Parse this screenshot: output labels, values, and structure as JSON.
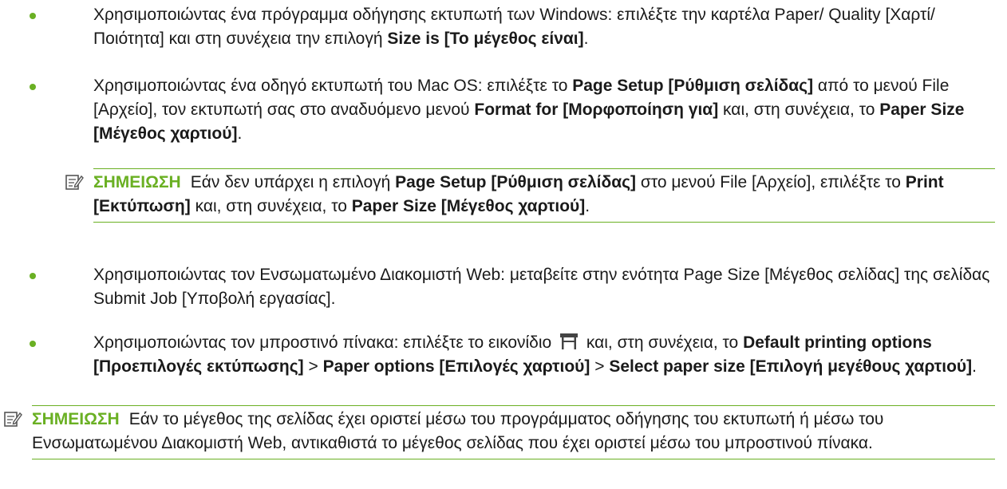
{
  "bullets": [
    {
      "parts": [
        {
          "t": "Χρησιμοποιώντας ένα πρόγραμμα οδήγησης εκτυπωτή των Windows: επιλέξτε την καρτέλα Paper/ Quality [Χαρτί/Ποιότητα] και στη συνέχεια την επιλογή "
        },
        {
          "t": "Size is [Το μέγεθος είναι]",
          "b": true
        },
        {
          "t": "."
        }
      ]
    },
    {
      "parts": [
        {
          "t": "Χρησιμοποιώντας ένα οδηγό εκτυπωτή του Mac OS: επιλέξτε το "
        },
        {
          "t": "Page Setup [Ρύθμιση σελίδας]",
          "b": true
        },
        {
          "t": " από το μενού File [Αρχείο], τον εκτυπωτή σας στο αναδυόμενο μενού "
        },
        {
          "t": "Format for [Μορφοποίηση για]",
          "b": true
        },
        {
          "t": " και, στη συνέχεια, το "
        },
        {
          "t": "Paper Size [Μέγεθος χαρτιού]",
          "b": true
        },
        {
          "t": "."
        }
      ]
    },
    {
      "parts": [
        {
          "t": "Χρησιμοποιώντας τον Ενσωματωμένο Διακομιστή Web: μεταβείτε στην ενότητα Page Size [Μέγεθος σελίδας] της σελίδας Submit Job [Υποβολή εργασίας]."
        }
      ]
    },
    {
      "parts": [
        {
          "t": "Χρησιμοποιώντας τον μπροστινό πίνακα: επιλέξτε το εικονίδιο "
        },
        {
          "icon": "printer-icon"
        },
        {
          "t": " και, στη συνέχεια, το "
        },
        {
          "t": "Default printing options [Προεπιλογές εκτύπωσης]",
          "b": true
        },
        {
          "t": " > "
        },
        {
          "t": "Paper options [Επιλογές χαρτιού]",
          "b": true
        },
        {
          "t": " > "
        },
        {
          "t": "Select paper size [Επιλογή μεγέθους χαρτιού]",
          "b": true
        },
        {
          "t": "."
        }
      ]
    }
  ],
  "note_inner": {
    "label": "ΣΗΜΕΙΩΣΗ",
    "parts": [
      {
        "t": "Εάν δεν υπάρχει η επιλογή "
      },
      {
        "t": "Page Setup [Ρύθμιση σελίδας]",
        "b": true
      },
      {
        "t": " στο μενού File [Αρχείο], επιλέξτε το "
      },
      {
        "t": "Print [Εκτύπωση]",
        "b": true
      },
      {
        "t": " και, στη συνέχεια, το "
      },
      {
        "t": "Paper Size [Μέγεθος χαρτιού]",
        "b": true
      },
      {
        "t": "."
      }
    ]
  },
  "note_outer": {
    "label": "ΣΗΜΕΙΩΣΗ",
    "parts": [
      {
        "t": "Εάν το μέγεθος της σελίδας έχει οριστεί μέσω του προγράμματος οδήγησης του εκτυπωτή ή μέσω του Ενσωματωμένου Διακομιστή Web, αντικαθιστά το μέγεθος σελίδας που έχει οριστεί μέσω του μπροστινού πίνακα."
      }
    ]
  },
  "colors": {
    "accent": "#6ab023",
    "text": "#1a1a1a"
  }
}
